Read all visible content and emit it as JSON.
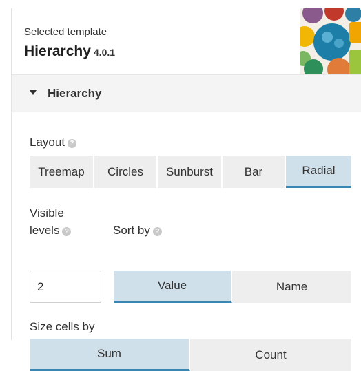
{
  "header": {
    "selected_label": "Selected template",
    "template_name": "Hierarchy",
    "template_version": "4.0.1"
  },
  "section": {
    "title": "Hierarchy"
  },
  "layout": {
    "label": "Layout",
    "options": [
      "Treemap",
      "Circles",
      "Sunburst",
      "Bar",
      "Radial"
    ],
    "selected": "Radial"
  },
  "visible_levels": {
    "label_line1": "Visible",
    "label_line2": "levels",
    "value": "2"
  },
  "sort_by": {
    "label": "Sort by",
    "options": [
      "Value",
      "Name"
    ],
    "selected": "Value"
  },
  "size_cells_by": {
    "label": "Size cells by",
    "options": [
      "Sum",
      "Count"
    ],
    "selected": "Sum"
  },
  "icons": {
    "help": "help-circle-icon",
    "caret": "caret-down-icon"
  },
  "colors": {
    "selected_bg": "#cfe0ea",
    "selected_underline": "#3a86b3",
    "button_bg": "#eeeeee"
  }
}
